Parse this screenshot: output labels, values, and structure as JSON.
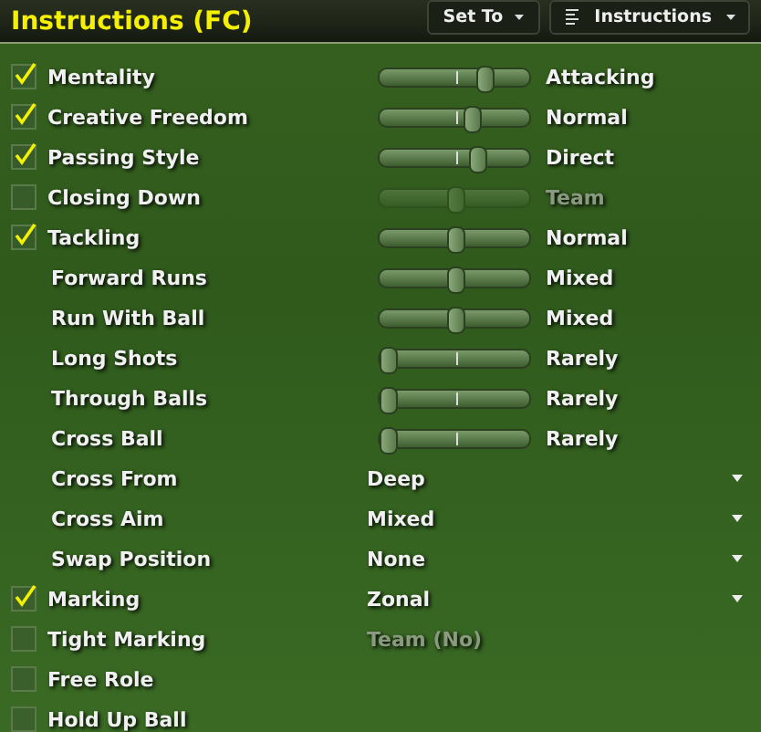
{
  "header": {
    "title": "Instructions (FC)",
    "buttons": [
      {
        "label": "Set To",
        "icon": false
      },
      {
        "label": "Instructions",
        "icon": true
      }
    ]
  },
  "rows": [
    {
      "label": "Mentality",
      "checked": true,
      "kind": "slider",
      "level": 0.72,
      "value": "Attacking",
      "disabled": false
    },
    {
      "label": "Creative Freedom",
      "checked": true,
      "kind": "slider",
      "level": 0.62,
      "value": "Normal",
      "disabled": false
    },
    {
      "label": "Passing Style",
      "checked": true,
      "kind": "slider",
      "level": 0.66,
      "value": "Direct",
      "disabled": false
    },
    {
      "label": "Closing Down",
      "checked": false,
      "kind": "slider",
      "level": 0.5,
      "value": "Team",
      "disabled": true
    },
    {
      "label": "Tackling",
      "checked": true,
      "kind": "slider",
      "level": 0.5,
      "value": "Normal",
      "disabled": false
    },
    {
      "label": "Forward Runs",
      "kind": "slider",
      "level": 0.5,
      "value": "Mixed",
      "disabled": false
    },
    {
      "label": "Run With Ball",
      "kind": "slider",
      "level": 0.5,
      "value": "Mixed",
      "disabled": false
    },
    {
      "label": "Long Shots",
      "kind": "slider",
      "level": 0,
      "value": "Rarely",
      "disabled": false
    },
    {
      "label": "Through Balls",
      "kind": "slider",
      "level": 0,
      "value": "Rarely",
      "disabled": false
    },
    {
      "label": "Cross Ball",
      "kind": "slider",
      "level": 0,
      "value": "Rarely",
      "disabled": false
    },
    {
      "label": "Cross From",
      "kind": "dropdown",
      "value": "Deep",
      "disabled": false
    },
    {
      "label": "Cross Aim",
      "kind": "dropdown",
      "value": "Mixed",
      "disabled": false
    },
    {
      "label": "Swap Position",
      "kind": "dropdown",
      "value": "None",
      "disabled": false
    },
    {
      "label": "Marking",
      "checked": true,
      "kind": "dropdown",
      "value": "Zonal",
      "disabled": false
    },
    {
      "label": "Tight Marking",
      "checked": false,
      "kind": "text",
      "value": "Team (No)",
      "disabled": true
    },
    {
      "label": "Free Role",
      "checked": false,
      "kind": "none"
    },
    {
      "label": "Hold Up Ball",
      "checked": false,
      "kind": "none"
    }
  ]
}
